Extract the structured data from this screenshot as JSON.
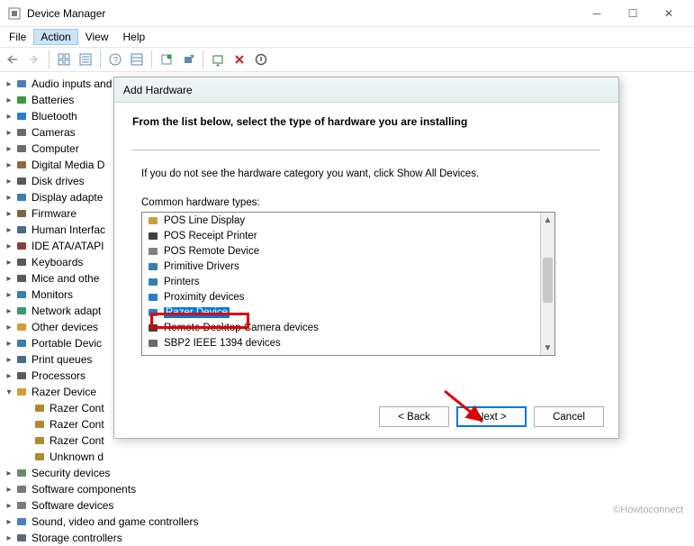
{
  "window": {
    "title": "Device Manager"
  },
  "menu": {
    "file": "File",
    "action": "Action",
    "view": "View",
    "help": "Help"
  },
  "tree": [
    {
      "label": "Audio inputs and outputs",
      "exp": true,
      "color": "#4a7ec0"
    },
    {
      "label": "Batteries",
      "exp": true,
      "color": "#3a9a3a"
    },
    {
      "label": "Bluetooth",
      "exp": true,
      "color": "#2a7dd0"
    },
    {
      "label": "Cameras",
      "exp": true,
      "color": "#6b6b6b"
    },
    {
      "label": "Computer",
      "exp": true,
      "color": "#6b6b6b"
    },
    {
      "label": "Digital Media D",
      "exp": true,
      "color": "#8a6a40"
    },
    {
      "label": "Disk drives",
      "exp": true,
      "color": "#5a5a5a"
    },
    {
      "label": "Display adapte",
      "exp": true,
      "color": "#3a7db0"
    },
    {
      "label": "Firmware",
      "exp": true,
      "color": "#7a6540"
    },
    {
      "label": "Human Interfac",
      "exp": true,
      "color": "#4a6a8a"
    },
    {
      "label": "IDE ATA/ATAPI",
      "exp": true,
      "color": "#8a4040"
    },
    {
      "label": "Keyboards",
      "exp": true,
      "color": "#5a5a5a"
    },
    {
      "label": "Mice and othe",
      "exp": true,
      "color": "#5a5a5a"
    },
    {
      "label": "Monitors",
      "exp": true,
      "color": "#3a7db0"
    },
    {
      "label": "Network adapt",
      "exp": true,
      "color": "#3a9a6a"
    },
    {
      "label": "Other devices",
      "exp": true,
      "color": "#d0a030"
    },
    {
      "label": "Portable Devic",
      "exp": true,
      "color": "#3a7db0"
    },
    {
      "label": "Print queues",
      "exp": true,
      "color": "#4a6a8a"
    },
    {
      "label": "Processors",
      "exp": true,
      "color": "#5a5a5a"
    },
    {
      "label": "Razer Device",
      "exp": false,
      "color": "#d0a030"
    },
    {
      "label": "Security devices",
      "exp": true,
      "color": "#6a8a6a"
    },
    {
      "label": "Software components",
      "exp": true,
      "color": "#7a7a7a"
    },
    {
      "label": "Software devices",
      "exp": true,
      "color": "#7a7a7a"
    },
    {
      "label": "Sound, video and game controllers",
      "exp": true,
      "color": "#4a7ec0"
    },
    {
      "label": "Storage controllers",
      "exp": true,
      "color": "#5a6a7a"
    }
  ],
  "razer_children": [
    {
      "label": "Razer Cont",
      "color": "#b08a30"
    },
    {
      "label": "Razer Cont",
      "color": "#b08a30"
    },
    {
      "label": "Razer Cont",
      "color": "#b08a30"
    },
    {
      "label": "Unknown d",
      "color": "#b08a30"
    }
  ],
  "dialog": {
    "title": "Add Hardware",
    "heading": "From the list below, select the type of hardware you are installing",
    "hint": "If you do not see the hardware category you want, click Show All Devices.",
    "list_label": "Common hardware types:",
    "items": [
      {
        "label": "POS Line Display",
        "color": "#c8a040"
      },
      {
        "label": "POS Receipt Printer",
        "color": "#404040"
      },
      {
        "label": "POS Remote Device",
        "color": "#808080"
      },
      {
        "label": "Primitive Drivers",
        "color": "#3a7db0"
      },
      {
        "label": "Printers",
        "color": "#3a7db0"
      },
      {
        "label": "Proximity devices",
        "color": "#2a7dd0"
      },
      {
        "label": "Razer Device",
        "color": "#2a7dd0",
        "sel": true
      },
      {
        "label": "Remote Desktop Camera devices",
        "color": "#404040"
      },
      {
        "label": "SBP2 IEEE 1394 devices",
        "color": "#6a6a6a"
      }
    ],
    "back": "< Back",
    "next": "Next >",
    "cancel": "Cancel"
  },
  "watermark": "©Howtoconnect"
}
